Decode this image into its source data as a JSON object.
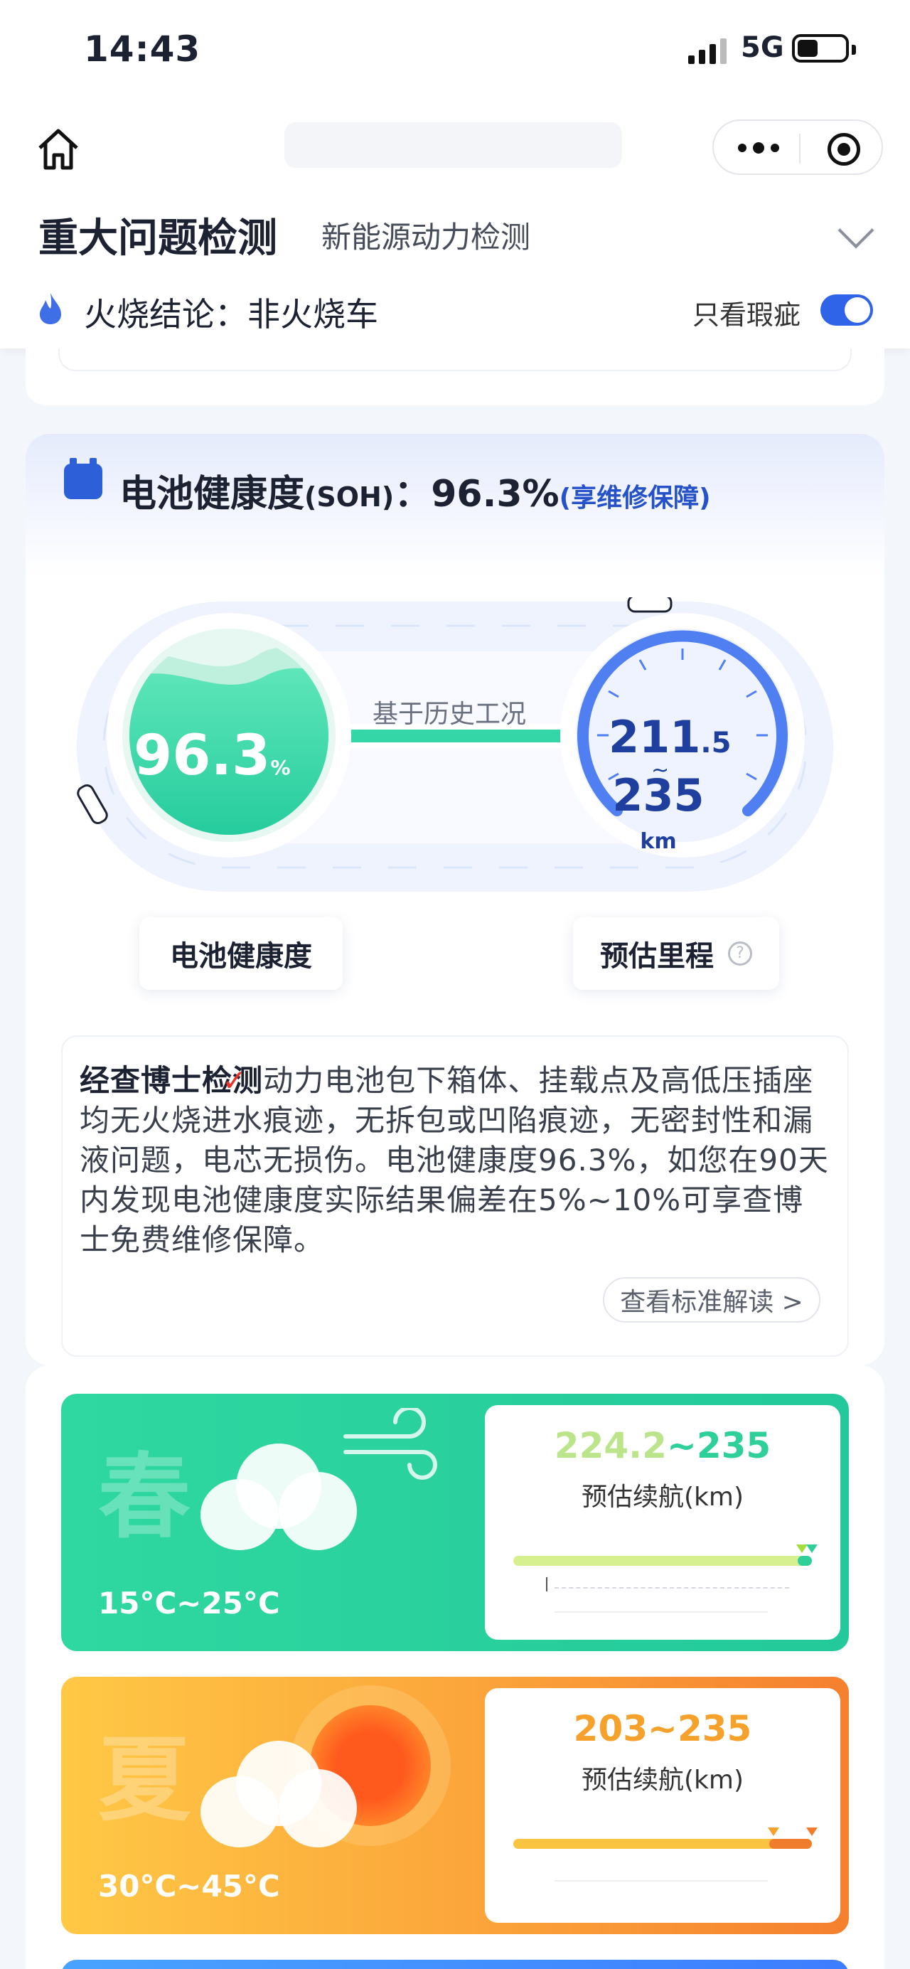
{
  "status_bar": {
    "time": "14:43",
    "network": "5G",
    "battery": "38"
  },
  "nav": {
    "home_icon": "home-icon",
    "more_icon": "more-dots-icon",
    "target_icon": "mini-program-close-icon"
  },
  "tabs": {
    "active": "重大问题检测",
    "secondary": "新能源动力检测"
  },
  "fire_row": {
    "label": "火烧结论：非火烧车",
    "filter_label": "只看瑕疵",
    "filter_on": true
  },
  "soh_card": {
    "title": "电池健康度",
    "title_abbr": "(SOH)",
    "title_colon": "：",
    "value": "96.3%",
    "guarantee": "(享维修保障)",
    "gauge_caption": "基于历史工况",
    "gauge_pct_num": "96.3",
    "gauge_pct_unit": "%",
    "range_low_int": "211",
    "range_low_dec": ".5",
    "range_high": "235",
    "range_unit": "km",
    "label_soh": "电池健康度",
    "label_range": "预估里程",
    "help_glyph": "?",
    "desc_bold": "经查博士检测",
    "desc_text": "动力电池包下箱体、挂载点及高低压插座均无火烧进水痕迹，无拆包或凹陷痕迹，无密封性和漏液问题，电芯无损伤。电池健康度96.3%，如您在90天内发现电池健康度实际结果偏差在5%~10%可享查博士免费维修保障。",
    "read_button": "查看标准解读 >",
    "soh_fraction": 0.963
  },
  "seasons": [
    {
      "name": "春",
      "temp": "15°C~25°C",
      "range_low": "224.2",
      "range_sep": "~",
      "range_high": "235",
      "range_label": "预估续航(km)",
      "accent": "#2fcf99"
    },
    {
      "name": "夏",
      "temp": "30°C~45°C",
      "range_low": "203",
      "range_sep": "~",
      "range_high": "235",
      "range_label": "预估续航(km)",
      "accent": "#f5a12b"
    }
  ]
}
